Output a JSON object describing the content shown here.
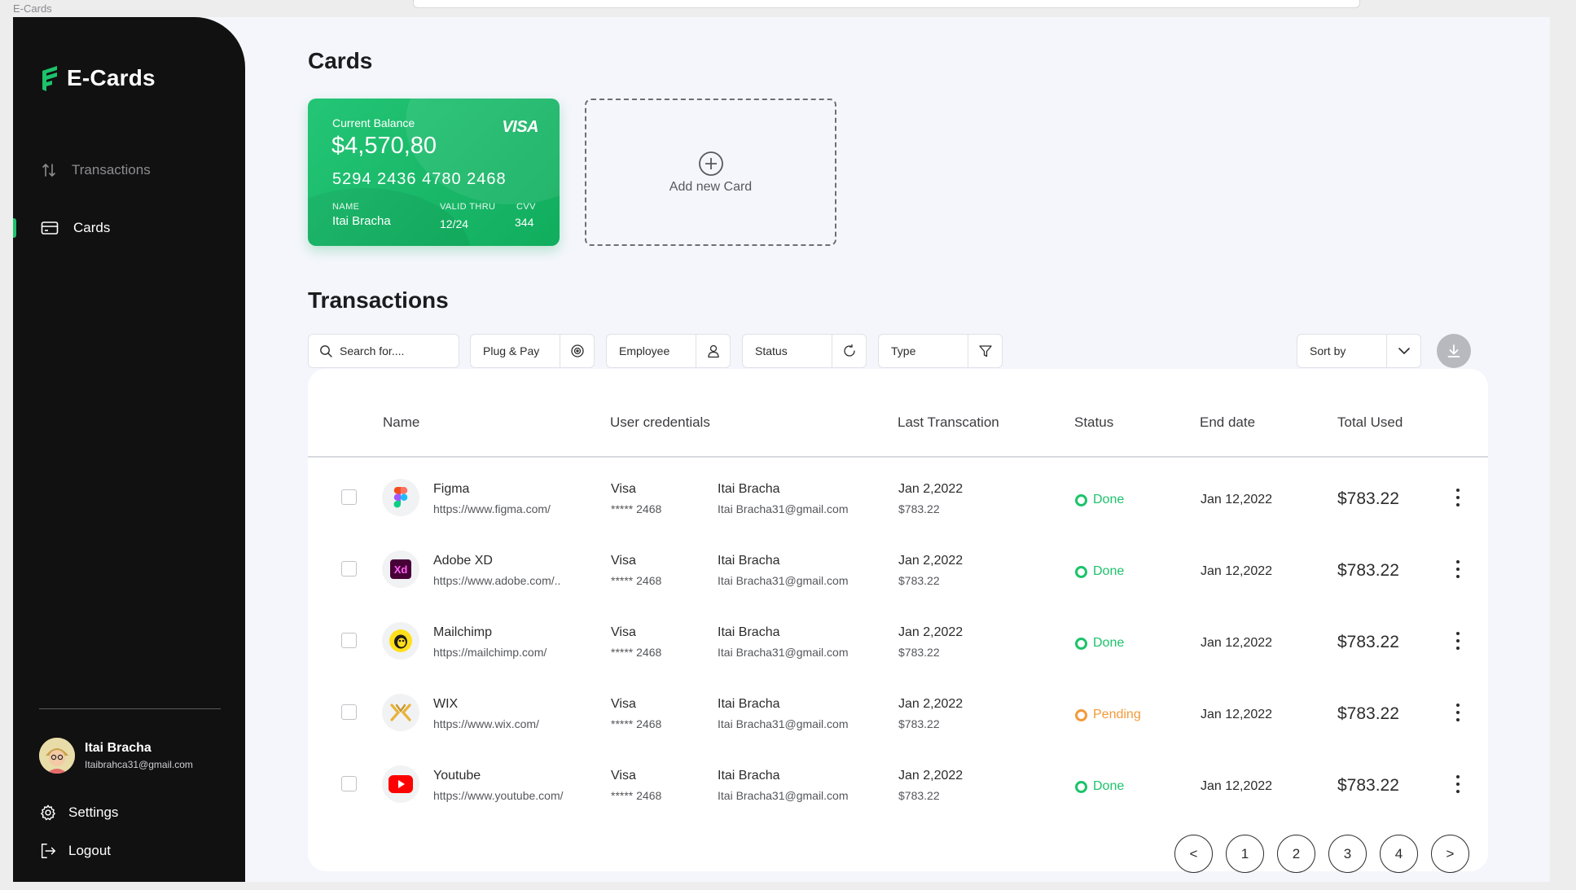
{
  "window": {
    "title": "E-Cards"
  },
  "sidebar": {
    "brand": "E-Cards",
    "nav": [
      {
        "label": "Transactions",
        "icon": "sort-arrows-icon",
        "active": false
      },
      {
        "label": "Cards",
        "icon": "card-icon",
        "active": true
      }
    ],
    "profile": {
      "name": "Itai Bracha",
      "email": "Itaibrahca31@gmail.com"
    },
    "settings_label": "Settings",
    "logout_label": "Logout"
  },
  "cards_section": {
    "title": "Cards",
    "card": {
      "balance_label": "Current Balance",
      "balance": "$4,570,80",
      "brand": "VISA",
      "number": "5294 2436 4780 2468",
      "name_label": "NAME",
      "name": "Itai Bracha",
      "valid_label": "VALID THRU",
      "valid": "12/24",
      "cvv_label": "CVV",
      "cvv": "344"
    },
    "add_label": "Add new Card"
  },
  "transactions": {
    "title": "Transactions",
    "search_placeholder": "Search for....",
    "filters": [
      {
        "label": "Plug & Pay",
        "icon": "target-icon"
      },
      {
        "label": "Employee",
        "icon": "user-icon"
      },
      {
        "label": "Status",
        "icon": "refresh-icon"
      },
      {
        "label": "Type",
        "icon": "filter-icon"
      }
    ],
    "sort_label": "Sort by",
    "columns": [
      "Name",
      "User credentials",
      "Last Transcation",
      "Status",
      "End date",
      "Total Used"
    ],
    "rows": [
      {
        "app": "Figma",
        "url": "https://www.figma.com/",
        "card_type": "Visa",
        "card_mask": "***** 2468",
        "user": "Itai Bracha",
        "email": "Itai Bracha31@gmail.com",
        "last_date": "Jan 2,2022",
        "last_amount": "$783.22",
        "status": "Done",
        "end_date": "Jan 12,2022",
        "total": "$783.22",
        "icon": "figma-icon"
      },
      {
        "app": "Adobe XD",
        "url": "https://www.adobe.com/..",
        "card_type": "Visa",
        "card_mask": "***** 2468",
        "user": "Itai Bracha",
        "email": "Itai Bracha31@gmail.com",
        "last_date": "Jan 2,2022",
        "last_amount": "$783.22",
        "status": "Done",
        "end_date": "Jan 12,2022",
        "total": "$783.22",
        "icon": "adobe-xd-icon"
      },
      {
        "app": "Mailchimp",
        "url": "https://mailchimp.com/",
        "card_type": "Visa",
        "card_mask": "***** 2468",
        "user": "Itai Bracha",
        "email": "Itai Bracha31@gmail.com",
        "last_date": "Jan 2,2022",
        "last_amount": "$783.22",
        "status": "Done",
        "end_date": "Jan 12,2022",
        "total": "$783.22",
        "icon": "mailchimp-icon"
      },
      {
        "app": "WIX",
        "url": "https://www.wix.com/",
        "card_type": "Visa",
        "card_mask": "***** 2468",
        "user": "Itai Bracha",
        "email": "Itai Bracha31@gmail.com",
        "last_date": "Jan 2,2022",
        "last_amount": "$783.22",
        "status": "Pending",
        "end_date": "Jan 12,2022",
        "total": "$783.22",
        "icon": "wix-icon"
      },
      {
        "app": "Youtube",
        "url": "https://www.youtube.com/",
        "card_type": "Visa",
        "card_mask": "***** 2468",
        "user": "Itai Bracha",
        "email": "Itai Bracha31@gmail.com",
        "last_date": "Jan 2,2022",
        "last_amount": "$783.22",
        "status": "Done",
        "end_date": "Jan 12,2022",
        "total": "$783.22",
        "icon": "youtube-icon"
      }
    ],
    "pagination": [
      "<",
      "1",
      "2",
      "3",
      "4",
      ">"
    ]
  },
  "colors": {
    "accent": "#1cc36b",
    "done": "#1cc36b",
    "pending": "#f39a3a",
    "sidebar": "#111111"
  }
}
